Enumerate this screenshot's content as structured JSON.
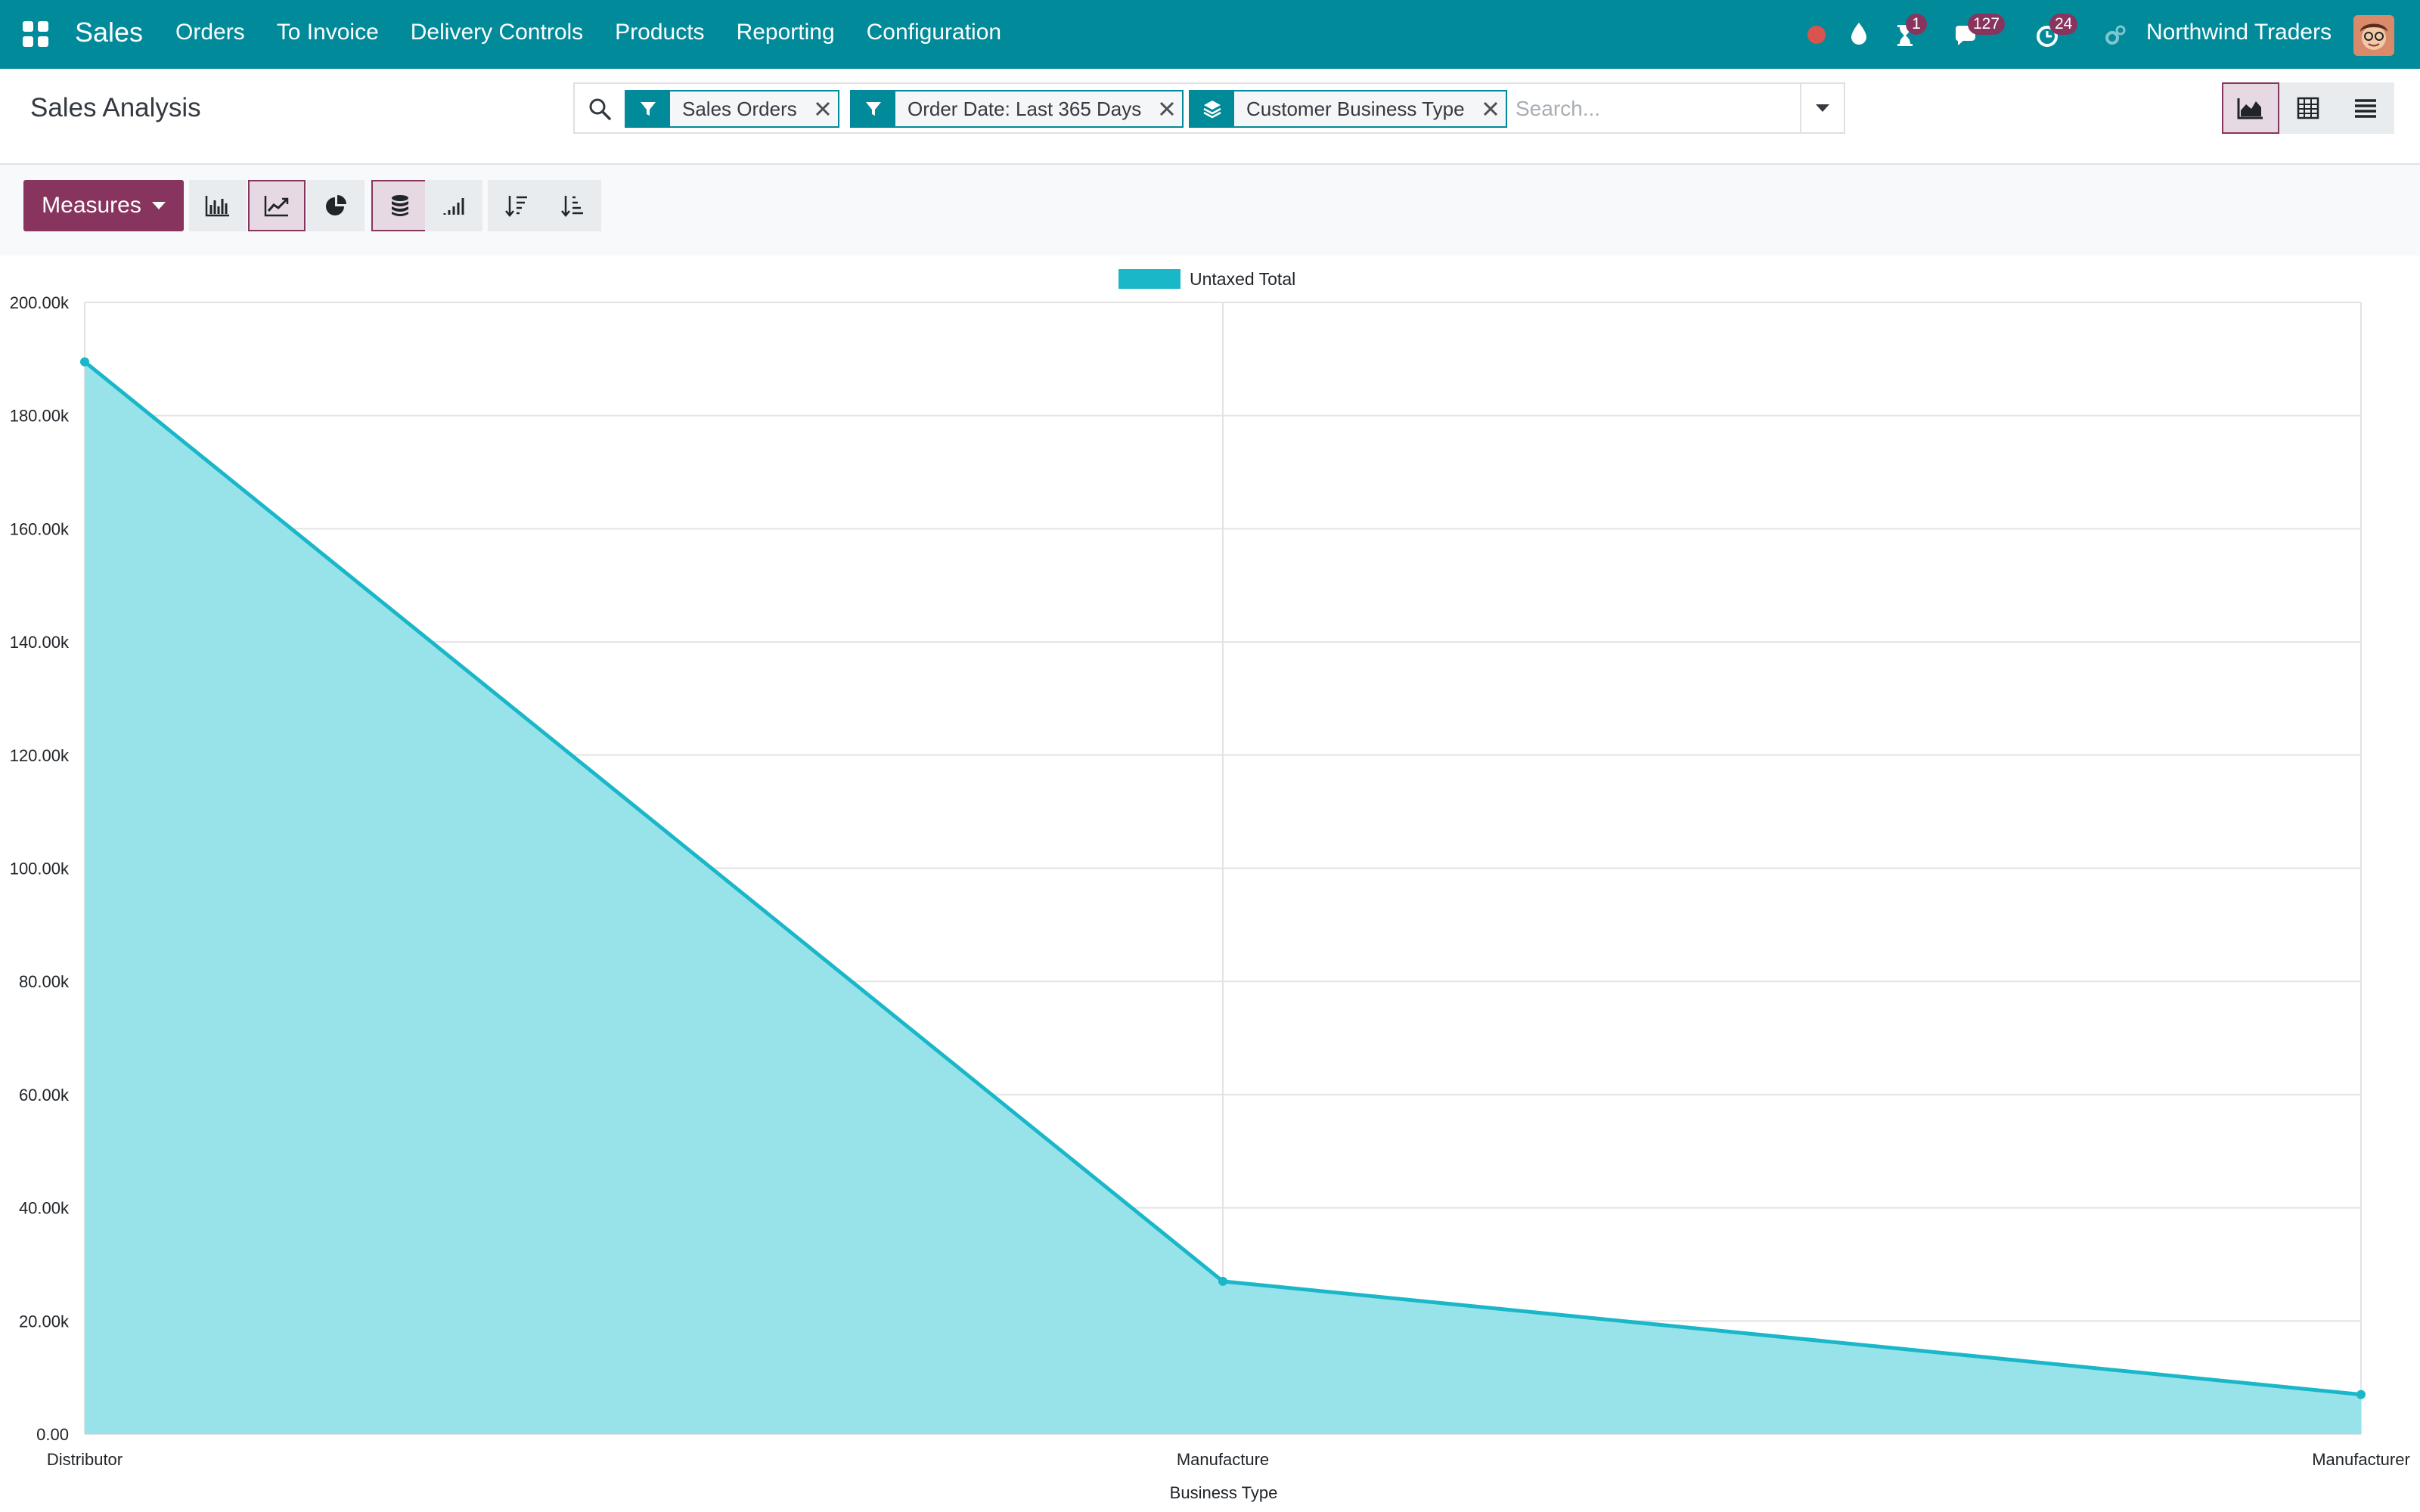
{
  "navbar": {
    "app_name": "Sales",
    "menu": [
      "Orders",
      "To Invoice",
      "Delivery Controls",
      "Products",
      "Reporting",
      "Configuration"
    ],
    "activity_badge": "1",
    "messages_badge": "127",
    "timer_badge": "24",
    "company": "Northwind Traders"
  },
  "control_panel": {
    "title": "Sales Analysis",
    "facets": [
      {
        "icon": "filter-icon",
        "label": "Sales Orders"
      },
      {
        "icon": "filter-icon",
        "label": "Order Date: Last 365 Days"
      },
      {
        "icon": "group-by-icon",
        "label": "Customer Business Type"
      }
    ],
    "search_placeholder": "Search..."
  },
  "graph_toolbar": {
    "measures_label": "Measures"
  },
  "colors": {
    "navbar": "#018a9a",
    "primary": "#87355e",
    "series_line": "#1ab7c9",
    "series_fill": "#98e3ea"
  },
  "chart_data": {
    "type": "area",
    "categories": [
      "Distributor",
      "Manufacture",
      "Manufacturer"
    ],
    "series": [
      {
        "name": "Untaxed Total",
        "values": [
          189500,
          27000,
          7000
        ]
      }
    ],
    "xlabel": "Business Type",
    "ylim": [
      0,
      200000
    ],
    "yticks": [
      "0.00",
      "20.00k",
      "40.00k",
      "60.00k",
      "80.00k",
      "100.00k",
      "120.00k",
      "140.00k",
      "160.00k",
      "180.00k",
      "200.00k"
    ],
    "legend": "top-center",
    "grid": true
  }
}
